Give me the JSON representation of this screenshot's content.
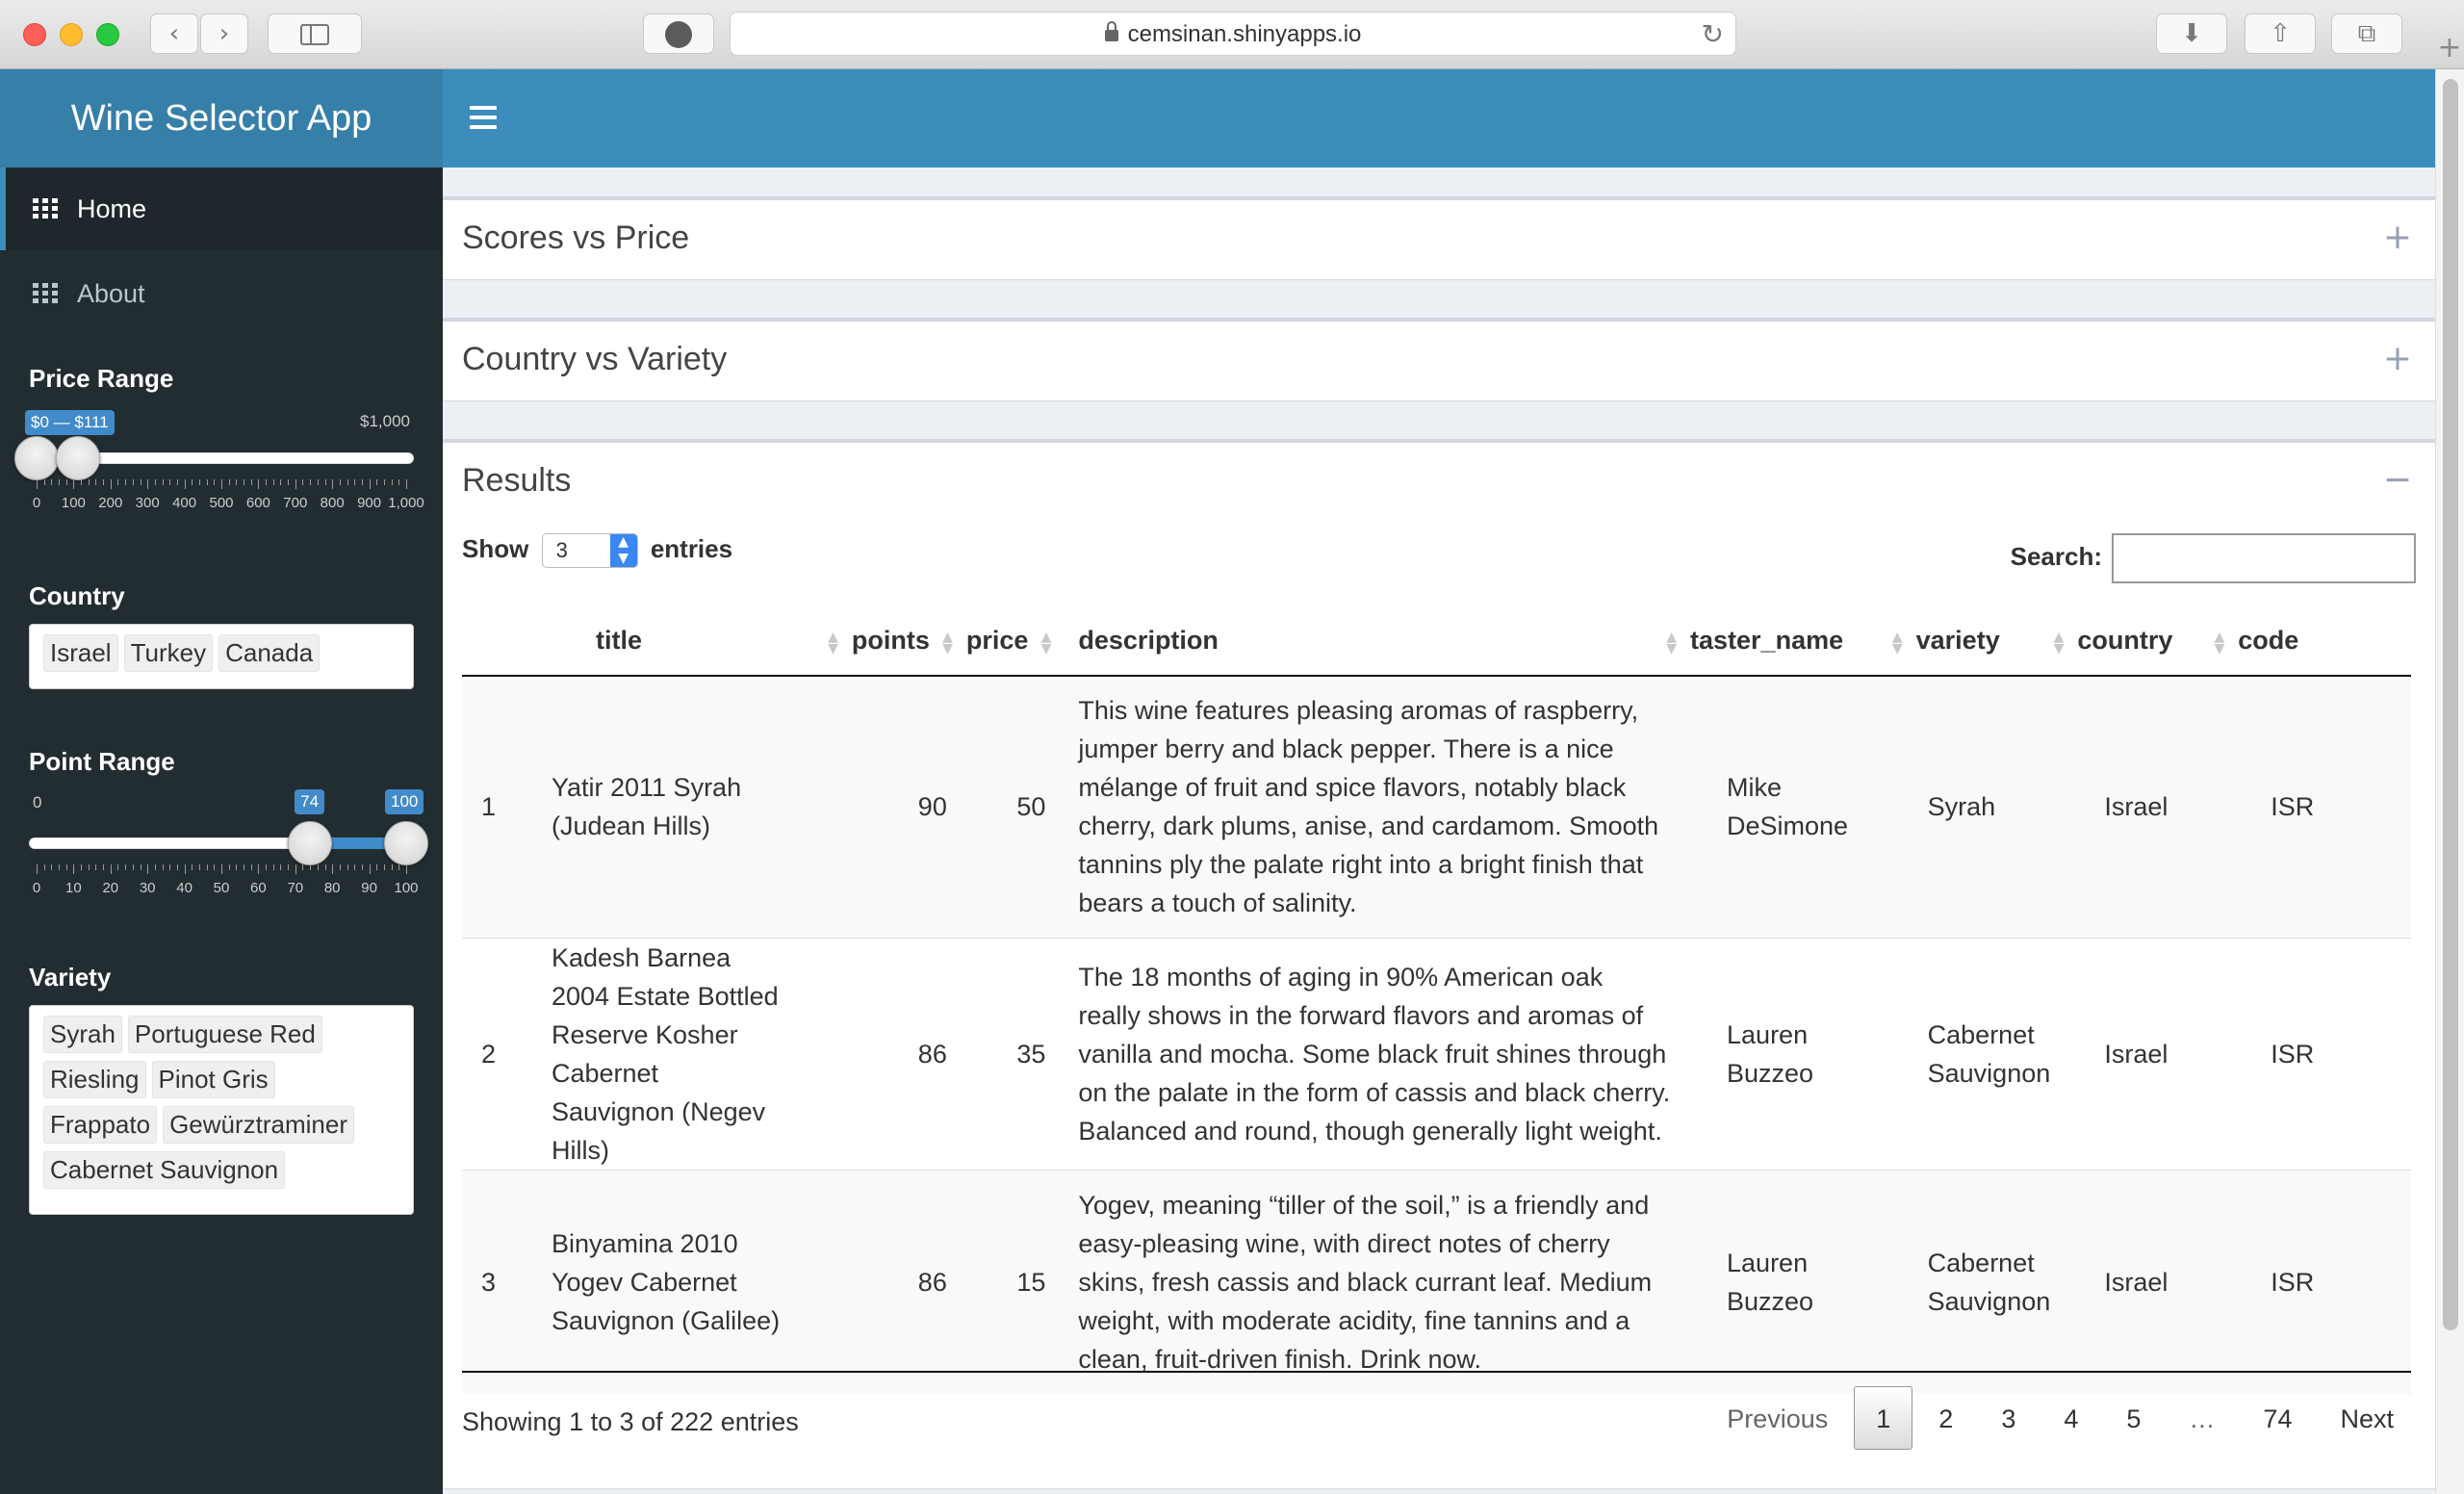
{
  "browser": {
    "url": "cemsinan.shinyapps.io",
    "back_icon": "‹",
    "forward_icon": "›",
    "reload_icon": "↻",
    "download_icon": "⬇",
    "share_icon": "⇧",
    "tabs_icon": "⧉",
    "new_tab_icon": "+"
  },
  "app": {
    "title": "Wine Selector App"
  },
  "sidebar": {
    "menu": [
      {
        "label": "Home",
        "active": true
      },
      {
        "label": "About",
        "active": false
      }
    ],
    "price_range": {
      "label": "Price Range",
      "badge": "$0 — $111",
      "max_label": "$1,000",
      "min": 0,
      "max": 1000,
      "from": 0,
      "to": 111,
      "ticks": [
        "0",
        "100",
        "200",
        "300",
        "400",
        "500",
        "600",
        "700",
        "800",
        "900",
        "1,000"
      ]
    },
    "country": {
      "label": "Country",
      "selected": [
        "Israel",
        "Turkey",
        "Canada"
      ]
    },
    "point_range": {
      "label": "Point Range",
      "min_label": "0",
      "min": 0,
      "max": 100,
      "from": 74,
      "to": 100,
      "from_label": "74",
      "to_label": "100",
      "ticks": [
        "0",
        "10",
        "20",
        "30",
        "40",
        "50",
        "60",
        "70",
        "80",
        "90",
        "100"
      ]
    },
    "variety": {
      "label": "Variety",
      "selected": [
        "Syrah",
        "Portuguese Red",
        "Riesling",
        "Pinot Gris",
        "Frappato",
        "Gewürztraminer",
        "Cabernet Sauvignon"
      ]
    }
  },
  "boxes": {
    "scores": {
      "title": "Scores vs Price",
      "tool": "+"
    },
    "country": {
      "title": "Country vs Variety",
      "tool": "+"
    },
    "results": {
      "title": "Results",
      "tool": "−"
    }
  },
  "table": {
    "show_label": "Show",
    "entries_value": "3",
    "entries_label": "entries",
    "search_label": "Search:",
    "search_value": "",
    "columns": [
      "",
      "title",
      "points",
      "price",
      "description",
      "taster_name",
      "variety",
      "country",
      "code"
    ],
    "rows": [
      {
        "n": "1",
        "title": "Yatir 2011 Syrah (Judean Hills)",
        "points": "90",
        "price": "50",
        "description": "This wine features pleasing aromas of raspberry, jumper berry and black pepper. There is a nice mélange of fruit and spice flavors, notably black cherry, dark plums, anise, and cardamom. Smooth tannins ply the palate right into a bright finish that bears a touch of salinity.",
        "taster": "Mike DeSimone",
        "variety": "Syrah",
        "country": "Israel",
        "code": "ISR"
      },
      {
        "n": "2",
        "title": "Kadesh Barnea 2004 Estate Bottled Reserve Kosher Cabernet Sauvignon (Negev Hills)",
        "points": "86",
        "price": "35",
        "description": "The 18 months of aging in 90% American oak really shows in the forward flavors and aromas of vanilla and mocha. Some black fruit shines through on the palate in the form of cassis and black cherry. Balanced and round, though generally light weight.",
        "taster": "Lauren Buzzeo",
        "variety": "Cabernet Sauvignon",
        "country": "Israel",
        "code": "ISR"
      },
      {
        "n": "3",
        "title": "Binyamina 2010 Yogev Cabernet Sauvignon (Galilee)",
        "points": "86",
        "price": "15",
        "description": "Yogev, meaning “tiller of the soil,” is a friendly and easy-pleasing wine, with direct notes of cherry skins, fresh cassis and black currant leaf. Medium weight, with moderate acidity, fine tannins and a clean, fruit-driven finish. Drink now.",
        "taster": "Lauren Buzzeo",
        "variety": "Cabernet Sauvignon",
        "country": "Israel",
        "code": "ISR"
      }
    ],
    "info": "Showing 1 to 3 of 222 entries",
    "pagination": [
      "Previous",
      "1",
      "2",
      "3",
      "4",
      "5",
      "…",
      "74",
      "Next"
    ]
  },
  "colors": {
    "logo_bg": "#367fa9",
    "navbar_bg": "#3c8dbc",
    "sidebar_bg": "#222d32",
    "slider_accent": "#428bca"
  }
}
